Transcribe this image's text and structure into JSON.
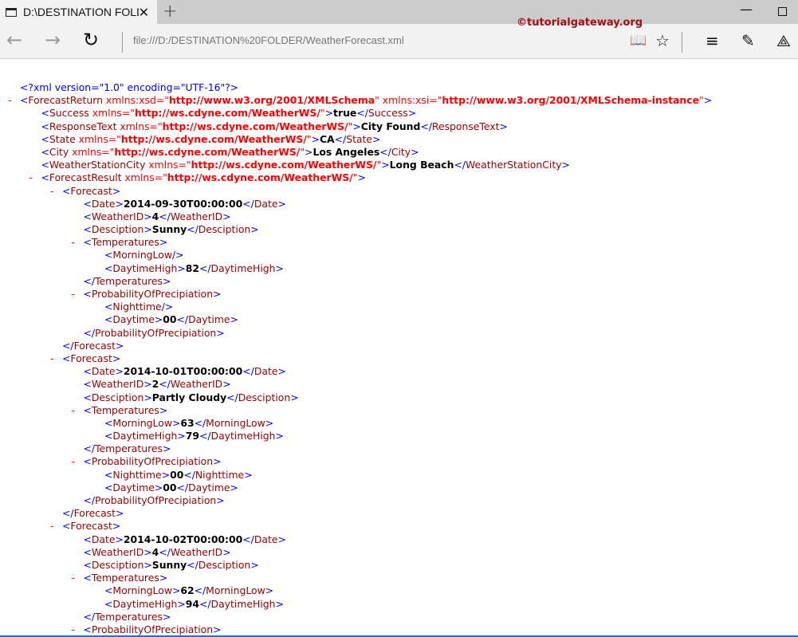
{
  "tab": {
    "title": "D:\\DESTINATION FOLDE",
    "close": "✕",
    "new_tab": "+"
  },
  "watermark": "©tutorialgateway.org",
  "window": {
    "minimize": "—"
  },
  "toolbar": {
    "back": "←",
    "forward": "→",
    "refresh": "↻",
    "url": "file:///D:/DESTINATION%20FOLDER/WeatherForecast.xml",
    "reading": "📖",
    "favorite": "☆",
    "hub": "≡",
    "note": "✎",
    "share": "⟁"
  },
  "xml": {
    "toggle": "-",
    "lines": [
      {
        "lvl": 0,
        "pi": "<?xml version=\"1.0\" encoding=\"UTF-16\"?>"
      },
      {
        "lvl": 0,
        "tog": true,
        "tag": "ForecastReturn",
        "attrs": [
          [
            "xmlns:xsd",
            "http://www.w3.org/2001/XMLSchema"
          ],
          [
            "xmlns:xsi",
            "http://www.w3.org/2001/XMLSchema-instance"
          ]
        ]
      },
      {
        "lvl": 1,
        "tag": "Success",
        "attrs": [
          [
            "xmlns",
            "http://ws.cdyne.com/WeatherWS/"
          ]
        ],
        "text": "true",
        "close": true
      },
      {
        "lvl": 1,
        "tag": "ResponseText",
        "attrs": [
          [
            "xmlns",
            "http://ws.cdyne.com/WeatherWS/"
          ]
        ],
        "text": "City Found",
        "close": true
      },
      {
        "lvl": 1,
        "tag": "State",
        "attrs": [
          [
            "xmlns",
            "http://ws.cdyne.com/WeatherWS/"
          ]
        ],
        "text": "CA",
        "close": true
      },
      {
        "lvl": 1,
        "tag": "City",
        "attrs": [
          [
            "xmlns",
            "http://ws.cdyne.com/WeatherWS/"
          ]
        ],
        "text": "Los Angeles",
        "close": true
      },
      {
        "lvl": 1,
        "tag": "WeatherStationCity",
        "attrs": [
          [
            "xmlns",
            "http://ws.cdyne.com/WeatherWS/"
          ]
        ],
        "text": "Long Beach",
        "close": true
      },
      {
        "lvl": 1,
        "tog": true,
        "tag": "ForecastResult",
        "attrs": [
          [
            "xmlns",
            "http://ws.cdyne.com/WeatherWS/"
          ]
        ]
      },
      {
        "lvl": 2,
        "tog": true,
        "tag": "Forecast"
      },
      {
        "lvl": 3,
        "tag": "Date",
        "text": "2014-09-30T00:00:00",
        "close": true
      },
      {
        "lvl": 3,
        "tag": "WeatherID",
        "text": "4",
        "close": true
      },
      {
        "lvl": 3,
        "tag": "Desciption",
        "text": "Sunny",
        "close": true
      },
      {
        "lvl": 3,
        "tog": true,
        "tag": "Temperatures"
      },
      {
        "lvl": 4,
        "tag": "MorningLow",
        "self": true
      },
      {
        "lvl": 4,
        "tag": "DaytimeHigh",
        "text": "82",
        "close": true
      },
      {
        "lvl": 3,
        "end": "Temperatures"
      },
      {
        "lvl": 3,
        "tog": true,
        "tag": "ProbabilityOfPrecipiation"
      },
      {
        "lvl": 4,
        "tag": "Nighttime",
        "self": true
      },
      {
        "lvl": 4,
        "tag": "Daytime",
        "text": "00",
        "close": true
      },
      {
        "lvl": 3,
        "end": "ProbabilityOfPrecipiation"
      },
      {
        "lvl": 2,
        "end": "Forecast"
      },
      {
        "lvl": 2,
        "tog": true,
        "tag": "Forecast"
      },
      {
        "lvl": 3,
        "tag": "Date",
        "text": "2014-10-01T00:00:00",
        "close": true
      },
      {
        "lvl": 3,
        "tag": "WeatherID",
        "text": "2",
        "close": true
      },
      {
        "lvl": 3,
        "tag": "Desciption",
        "text": "Partly Cloudy",
        "close": true
      },
      {
        "lvl": 3,
        "tog": true,
        "tag": "Temperatures"
      },
      {
        "lvl": 4,
        "tag": "MorningLow",
        "text": "63",
        "close": true
      },
      {
        "lvl": 4,
        "tag": "DaytimeHigh",
        "text": "79",
        "close": true
      },
      {
        "lvl": 3,
        "end": "Temperatures"
      },
      {
        "lvl": 3,
        "tog": true,
        "tag": "ProbabilityOfPrecipiation"
      },
      {
        "lvl": 4,
        "tag": "Nighttime",
        "text": "00",
        "close": true
      },
      {
        "lvl": 4,
        "tag": "Daytime",
        "text": "00",
        "close": true
      },
      {
        "lvl": 3,
        "end": "ProbabilityOfPrecipiation"
      },
      {
        "lvl": 2,
        "end": "Forecast"
      },
      {
        "lvl": 2,
        "tog": true,
        "tag": "Forecast"
      },
      {
        "lvl": 3,
        "tag": "Date",
        "text": "2014-10-02T00:00:00",
        "close": true
      },
      {
        "lvl": 3,
        "tag": "WeatherID",
        "text": "4",
        "close": true
      },
      {
        "lvl": 3,
        "tag": "Desciption",
        "text": "Sunny",
        "close": true
      },
      {
        "lvl": 3,
        "tog": true,
        "tag": "Temperatures"
      },
      {
        "lvl": 4,
        "tag": "MorningLow",
        "text": "62",
        "close": true
      },
      {
        "lvl": 4,
        "tag": "DaytimeHigh",
        "text": "94",
        "close": true
      },
      {
        "lvl": 3,
        "end": "Temperatures"
      },
      {
        "lvl": 3,
        "tog": true,
        "tag": "ProbabilityOfPrecipiation"
      }
    ]
  }
}
